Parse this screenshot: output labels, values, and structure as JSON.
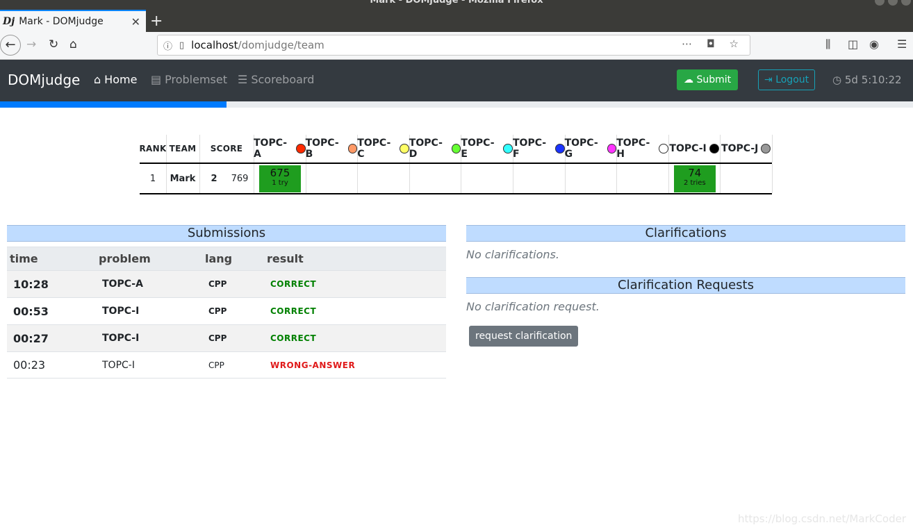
{
  "window": {
    "title": "Mark - DOMjudge - Mozilla Firefox"
  },
  "browser": {
    "tab_favicon": "Dj",
    "tab_title": "Mark - DOMjudge",
    "url_host": "localhost",
    "url_path": "/domjudge/team"
  },
  "nav": {
    "brand": "DOMjudge",
    "home": "Home",
    "problemset": "Problemset",
    "scoreboard": "Scoreboard",
    "submit": "Submit",
    "logout": "Logout",
    "clock": "5d 5:10:22",
    "progress_fraction": 0.248
  },
  "scoreboard": {
    "headers": {
      "rank": "RANK",
      "team": "TEAM",
      "score": "SCORE"
    },
    "problems": [
      {
        "label": "TOPC-A",
        "color": "#ff2a00"
      },
      {
        "label": "TOPC-B",
        "color": "#ff9966"
      },
      {
        "label": "TOPC-C",
        "color": "#ffff66"
      },
      {
        "label": "TOPC-D",
        "color": "#66ff33"
      },
      {
        "label": "TOPC-E",
        "color": "#33ffff"
      },
      {
        "label": "TOPC-F",
        "color": "#1a33ff"
      },
      {
        "label": "TOPC-G",
        "color": "#ff33ff"
      },
      {
        "label": "TOPC-H",
        "color": "#ffffff"
      },
      {
        "label": "TOPC-I",
        "color": "#000000"
      },
      {
        "label": "TOPC-J",
        "color": "#999999"
      }
    ],
    "row": {
      "rank": "1",
      "team": "Mark",
      "solved": "2",
      "time": "769",
      "cells": [
        {
          "problem": 0,
          "time": "675",
          "tries": "1 try"
        },
        {
          "problem": 8,
          "time": "74",
          "tries": "2 tries"
        }
      ]
    }
  },
  "submissions": {
    "title": "Submissions",
    "headers": {
      "time": "time",
      "problem": "problem",
      "lang": "lang",
      "result": "result"
    },
    "rows": [
      {
        "time": "10:28",
        "problem": "TOPC-A",
        "lang": "CPP",
        "result": "CORRECT"
      },
      {
        "time": "00:53",
        "problem": "TOPC-I",
        "lang": "CPP",
        "result": "CORRECT"
      },
      {
        "time": "00:27",
        "problem": "TOPC-I",
        "lang": "CPP",
        "result": "CORRECT"
      },
      {
        "time": "00:23",
        "problem": "TOPC-I",
        "lang": "CPP",
        "result": "WRONG-ANSWER"
      }
    ]
  },
  "clarifications": {
    "title": "Clarifications",
    "empty": "No clarifications.",
    "requests_title": "Clarification Requests",
    "requests_empty": "No clarification request.",
    "request_button": "request clarification"
  },
  "watermark": "https://blog.csdn.net/MarkCoder"
}
